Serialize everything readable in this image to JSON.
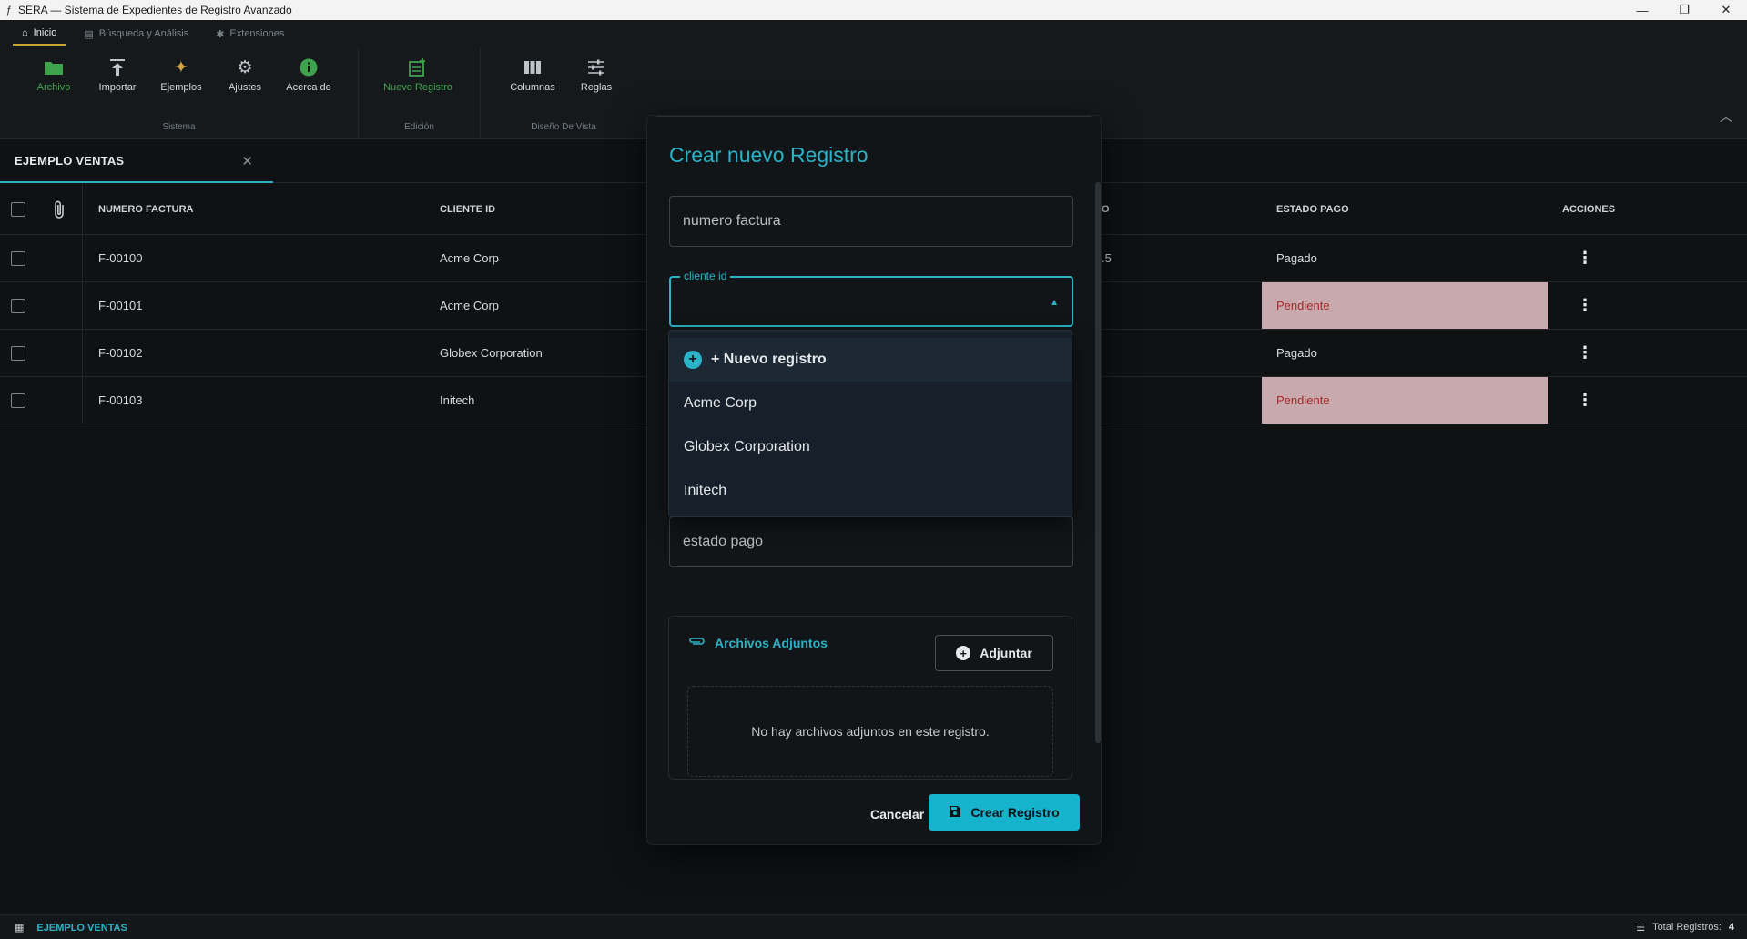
{
  "window": {
    "title": "SERA — Sistema de Expedientes de Registro Avanzado",
    "controls": [
      "—",
      "❐",
      "✕"
    ]
  },
  "ribbon": {
    "tabs": [
      {
        "label": "Inicio",
        "icon": "home-icon"
      },
      {
        "label": "Búsqueda y Análisis",
        "icon": "table-icon"
      },
      {
        "label": "Extensiones",
        "icon": "puzzle-icon"
      }
    ],
    "groups": [
      {
        "label": "Sistema",
        "items": [
          {
            "label": "Archivo",
            "icon": "folder-icon"
          },
          {
            "label": "Importar",
            "icon": "upload-icon"
          },
          {
            "label": "Ejemplos",
            "icon": "sparkle-icon"
          },
          {
            "label": "Ajustes",
            "icon": "gear-icon"
          },
          {
            "label": "Acerca de",
            "icon": "info-icon"
          }
        ]
      },
      {
        "label": "Edición",
        "items": [
          {
            "label": "Nuevo Registro",
            "icon": "add-record-icon"
          }
        ]
      },
      {
        "label": "Diseño De Vista",
        "items": [
          {
            "label": "Columnas",
            "icon": "columns-icon"
          },
          {
            "label": "Reglas",
            "icon": "sliders-icon"
          }
        ]
      }
    ]
  },
  "doc_tab": {
    "name": "EJEMPLO VENTAS"
  },
  "table": {
    "headers": [
      "NUMERO FACTURA",
      "CLIENTE ID",
      "O",
      "ESTADO PAGO",
      "ACCIONES"
    ],
    "rows": [
      {
        "numero": "F-00100",
        "cliente": "Acme Corp",
        "partial": ".5",
        "estado": "Pagado"
      },
      {
        "numero": "F-00101",
        "cliente": "Acme Corp",
        "partial": "",
        "estado": "Pendiente"
      },
      {
        "numero": "F-00102",
        "cliente": "Globex Corporation",
        "partial": "",
        "estado": "Pagado"
      },
      {
        "numero": "F-00103",
        "cliente": "Initech",
        "partial": "",
        "estado": "Pendiente"
      }
    ]
  },
  "dialog": {
    "title": "Crear nuevo Registro",
    "fields": {
      "numero_factura": "numero factura",
      "cliente_id_label": "cliente id",
      "estado_pago": "estado pago"
    },
    "dropdown": {
      "new_label": "+ Nuevo registro",
      "options": [
        "Acme Corp",
        "Globex Corporation",
        "Initech"
      ]
    },
    "attachments": {
      "title": "Archivos Adjuntos",
      "button": "Adjuntar",
      "empty": "No hay archivos adjuntos en este registro."
    },
    "cancel": "Cancelar",
    "create": "Crear Registro"
  },
  "status": {
    "tab_label": "EJEMPLO VENTAS",
    "total_label": "Total Registros:",
    "total_value": "4"
  },
  "colors": {
    "accent": "#2ab3c7",
    "ribbon_gold": "#c7a532",
    "green": "#3fa34d",
    "pending_bg": "#c8a9ad",
    "pending_text": "#a52a2a"
  }
}
